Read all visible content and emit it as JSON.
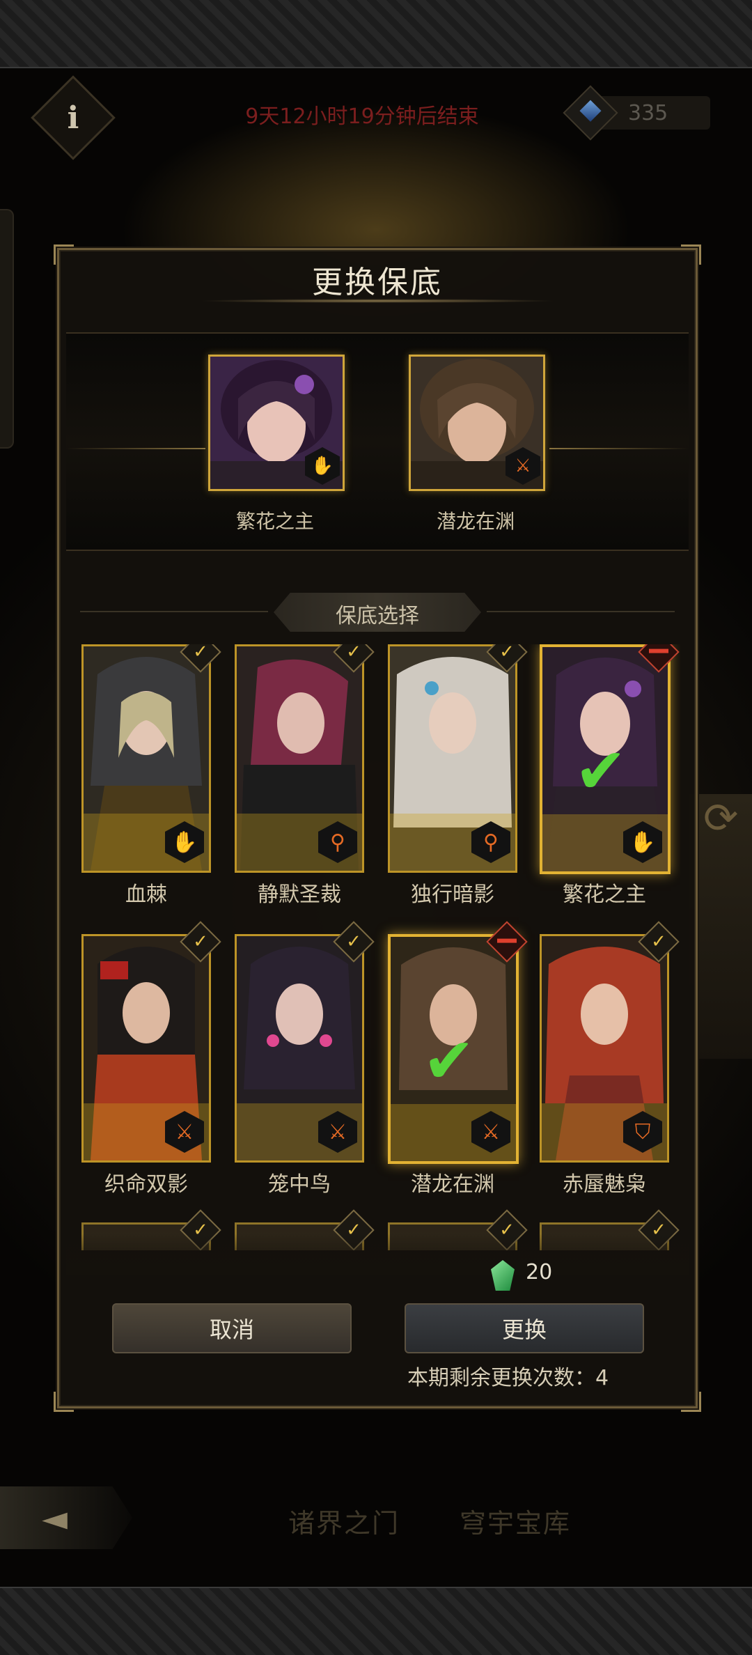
{
  "header": {
    "countdown": "9天12小时19分钟后结束",
    "currency_amount": "335"
  },
  "modal": {
    "title": "更换保底",
    "featured": [
      {
        "name": "繁花之主",
        "class_icon": "hand-icon"
      },
      {
        "name": "潜龙在渊",
        "class_icon": "sword-icon"
      }
    ],
    "section_label": "保底选择",
    "heroes": [
      {
        "name": "血棘",
        "class_icon": "hand-icon",
        "state": "checked"
      },
      {
        "name": "静默圣裁",
        "class_icon": "staff-icon",
        "state": "checked"
      },
      {
        "name": "独行暗影",
        "class_icon": "staff-icon",
        "state": "checked"
      },
      {
        "name": "繁花之主",
        "class_icon": "hand-icon",
        "state": "selected"
      },
      {
        "name": "织命双影",
        "class_icon": "sword-icon",
        "state": "checked"
      },
      {
        "name": "笼中鸟",
        "class_icon": "sword-icon",
        "state": "checked"
      },
      {
        "name": "潜龙在渊",
        "class_icon": "sword-icon",
        "state": "selected"
      },
      {
        "name": "赤蜃魅枭",
        "class_icon": "shield-icon",
        "state": "checked"
      }
    ],
    "cost": "20",
    "cancel_label": "取消",
    "confirm_label": "更换",
    "remaining_label": "本期剩余更换次数：4"
  },
  "bottom_nav": {
    "tab1": "诸界之门",
    "tab2": "穹宇宝库"
  },
  "colors": {
    "accent_gold": "#cfa53a",
    "countdown_red": "#7b1e1e",
    "check_green": "#56d43a",
    "class_orange": "#e56a24"
  }
}
